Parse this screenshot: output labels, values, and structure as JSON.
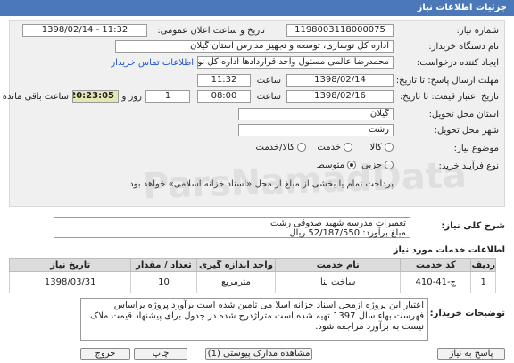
{
  "header": {
    "title": "جزئیات اطلاعات نیاز"
  },
  "fields": {
    "need_number_label": "شماره نیاز:",
    "need_number": "1198003118000075",
    "announce_label": "تاریخ و ساعت اعلان عمومی:",
    "announce_value": "1398/02/14 - 11:32",
    "buyer_label": "نام دستگاه خریدار:",
    "buyer_value": "اداره کل نوسازی، توسعه و تجهیز مدارس استان گیلان",
    "creator_label": "ایجاد کننده درخواست:",
    "creator_value": "محمدرضا عالمی مسئول واحد قراردادها اداره کل نوسازی، توسعه و تجهیز مدارس",
    "contact_link": "اطلاعات تماس خریدار",
    "send_deadline_label": "مهلت ارسال پاسخ: تا تاریخ:",
    "send_date": "1398/02/14",
    "time_label": "ساعت",
    "send_time": "11:32",
    "validity_label": "تاریخ اعتبار قیمت: تا تاریخ:",
    "valid_date": "1398/02/16",
    "valid_time": "08:00",
    "day_count": "1",
    "day_and_label": "روز و",
    "remaining_time": "20:23:05",
    "remaining_label": "ساعت باقی مانده",
    "province_label": "استان محل تحویل:",
    "province_value": "گیلان",
    "city_label": "شهر محل تحویل:",
    "city_value": "رشت",
    "category_label": "موضوع نیاز:",
    "category_options": [
      "کالا",
      "خدمت",
      "کالا/خدمت"
    ],
    "process_label": "نوع فرآیند خرید:",
    "process_options": [
      "جزیی",
      "متوسط"
    ],
    "process_note": "پرداخت تمام یا بخشی از مبلغ از محل «اسناد خزانه اسلامی» خواهد بود."
  },
  "description": {
    "label": "شرح کلی نیاز:",
    "line1": "تعمیرات مدرسه شهید صدوقی رشت",
    "line2": "مبلغ برآورد: 52/187/550 ریال"
  },
  "services": {
    "title": "اطلاعات خدمات مورد نیاز",
    "headers": [
      "ردیف",
      "کد خدمت",
      "نام خدمت",
      "واحد اندازه گیری",
      "تعداد / مقدار",
      "تاریخ نیاز"
    ],
    "rows": [
      [
        "1",
        "ج-41-410",
        "ساخت بنا",
        "مترمربع",
        "10",
        "1398/03/31"
      ]
    ]
  },
  "buyer_notes": {
    "label": "توضیحات خریدار:",
    "text": "اعتبار این پروژه ازمحل اسناد خزانه اسلا می تامین شده است برآورد پروژه براساس فهرست بهاء سال 1397 تهیه شده است متراژدرج شده در جدول برای پیشنهاد قیمت ملاک نیست به برآورد مراجعه شود."
  },
  "buttons": {
    "exit": "خروج",
    "print": "چاپ",
    "attachments": "مشاهده مدارک پیوستی (1)",
    "reply": "پاسخ به نیاز"
  },
  "watermark": "ParsNamadData"
}
